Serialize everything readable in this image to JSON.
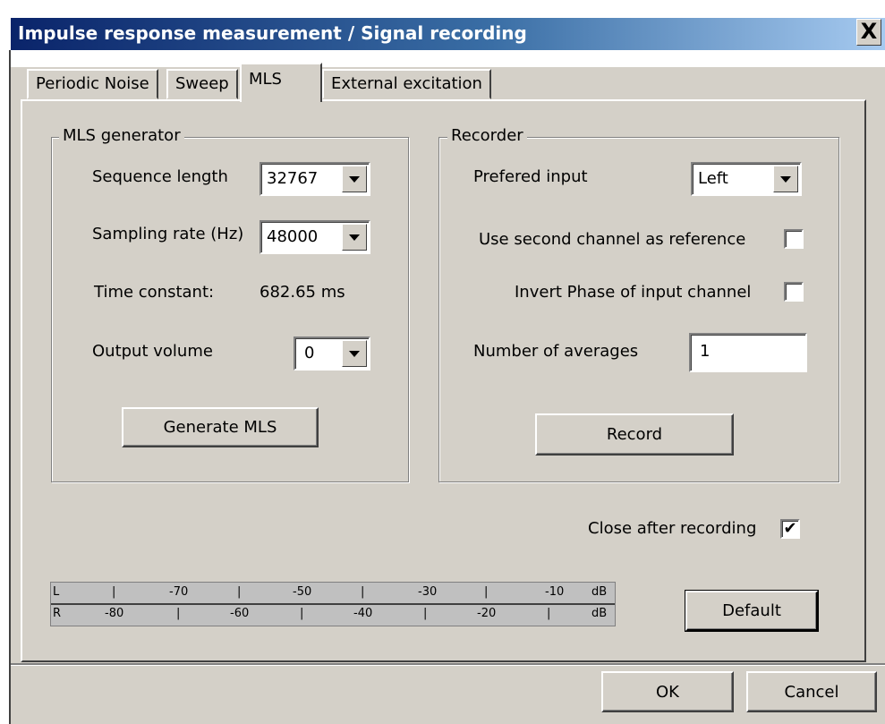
{
  "window": {
    "title": "Impulse response measurement / Signal recording",
    "close_label": "X"
  },
  "tabs": [
    {
      "label": "Periodic Noise",
      "active": false
    },
    {
      "label": "Sweep",
      "active": false
    },
    {
      "label": "MLS",
      "active": true
    },
    {
      "label": "External excitation",
      "active": false
    }
  ],
  "mls_generator": {
    "title": "MLS generator",
    "sequence_length_label": "Sequence length",
    "sequence_length_value": "32767",
    "sampling_rate_label": "Sampling rate (Hz)",
    "sampling_rate_value": "48000",
    "time_constant_label": "Time constant:",
    "time_constant_value": "682.65 ms",
    "output_volume_label": "Output volume",
    "output_volume_value": "0",
    "generate_button": "Generate MLS"
  },
  "recorder": {
    "title": "Recorder",
    "prefered_input_label": "Prefered input",
    "prefered_input_value": "Left",
    "second_channel_label": "Use second channel as reference",
    "second_channel_checked": false,
    "invert_phase_label": "Invert Phase of input channel",
    "invert_phase_checked": false,
    "averages_label": "Number of averages",
    "averages_value": "1",
    "record_button": "Record"
  },
  "close_after_recording": {
    "label": "Close after recording",
    "checked": true,
    "mark": "✔"
  },
  "level_meter": {
    "left_channel": "L",
    "right_channel": "R",
    "top_labels": [
      "-70",
      "-50",
      "-30",
      "-10",
      "dB"
    ],
    "bottom_labels": [
      "-80",
      "-60",
      "-40",
      "-20",
      "dB"
    ]
  },
  "buttons": {
    "default": "Default",
    "ok": "OK",
    "cancel": "Cancel"
  },
  "colors": {
    "face": "#d4d0c8",
    "titlebar_start": "#0a246a",
    "titlebar_end": "#a6caf0"
  }
}
